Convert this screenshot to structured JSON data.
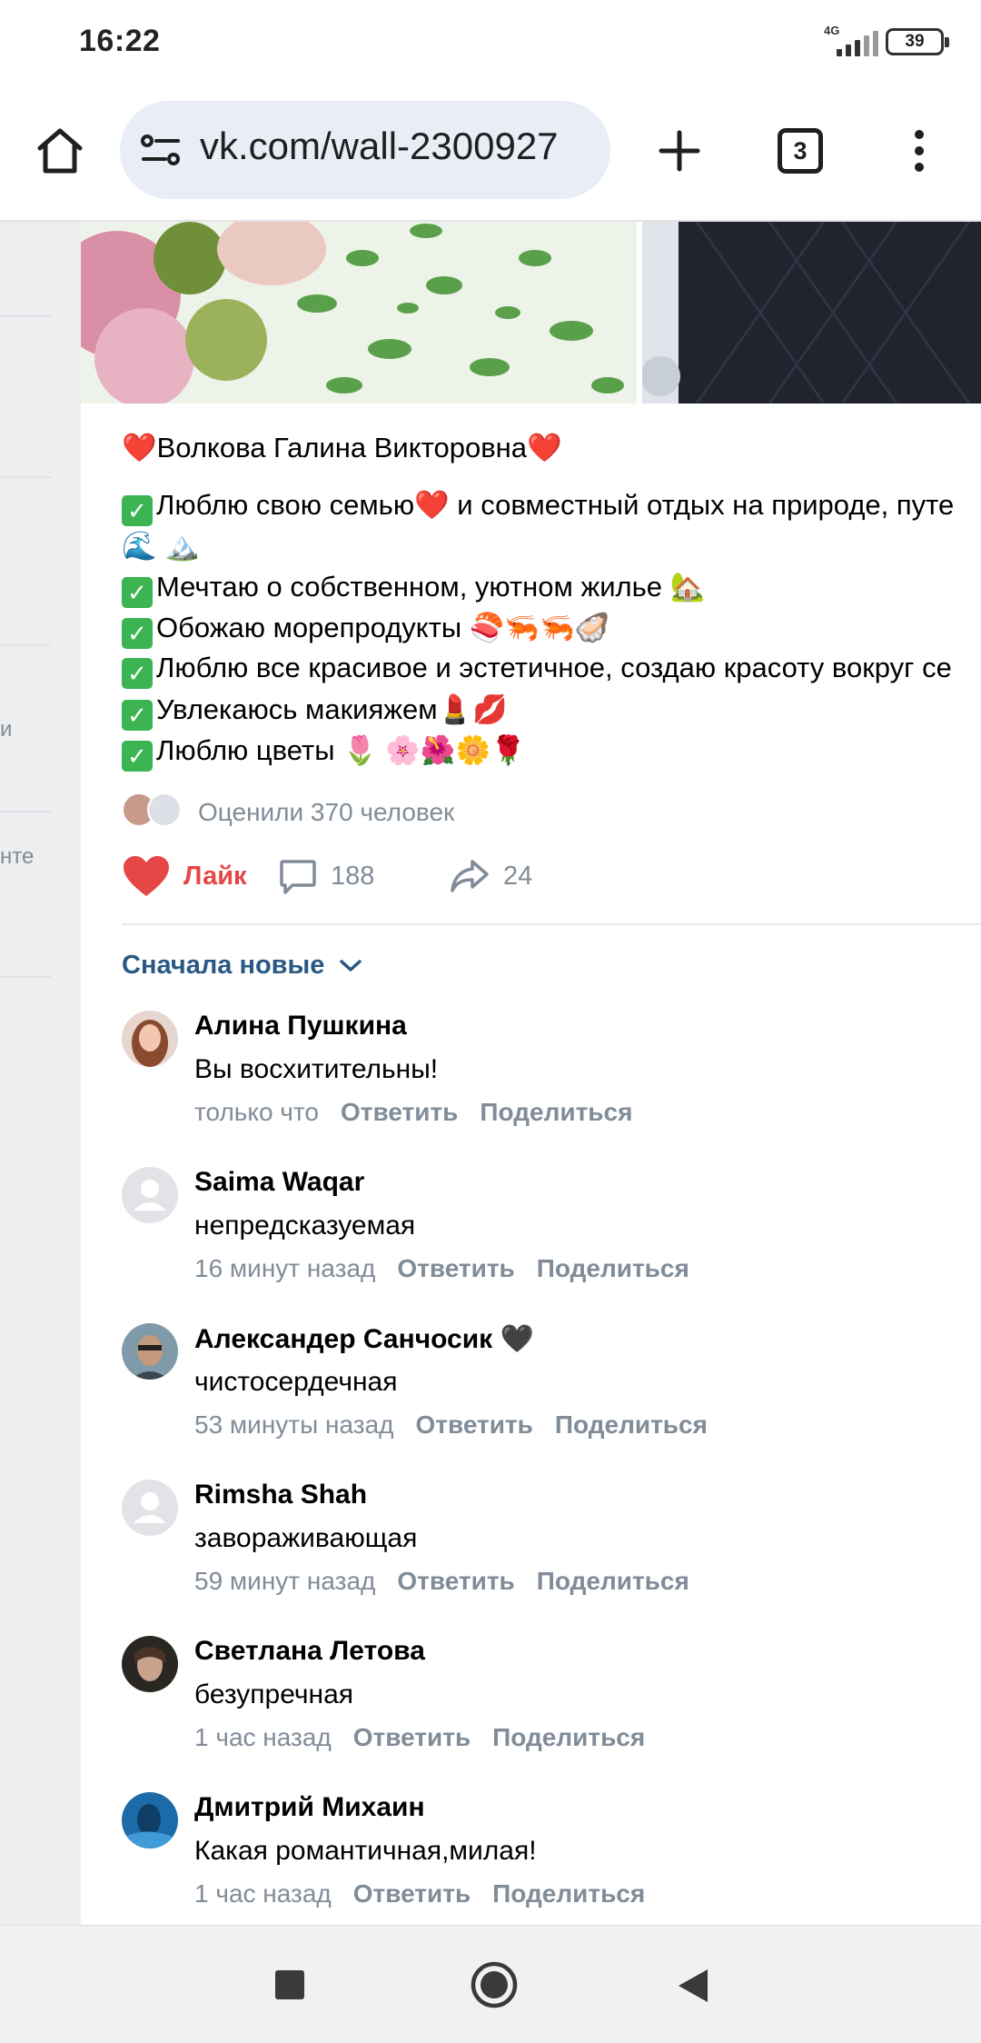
{
  "status_bar": {
    "time": "16:22",
    "network": "4G",
    "battery": "39"
  },
  "browser": {
    "url": "vk.com/wall-2300927",
    "tab_count": "3"
  },
  "sidebar_fragments": [
    "и",
    "нте"
  ],
  "post": {
    "title": "❤️Волкова Галина Викторовна❤️",
    "lines": [
      "Люблю свою семью❤️ и совместный отдых на природе, путе",
      "🌊 🏔️",
      "Мечтаю о собственном, уютном жилье 🏡",
      "Обожаю морепродукты 🍣🦐🦐🦪",
      "Люблю все красивое и эстетичное, создаю красоту вокруг се",
      "Увлекаюсь макияжем💄💋",
      "Люблю цветы 🌷 🌸🌺🌼🌹"
    ],
    "liked_by": "Оценили 370 человек",
    "like_label": "Лайк",
    "comments_count": "188",
    "shares_count": "24"
  },
  "comments_section": {
    "sort_label": "Сначала новые",
    "reply_label": "Ответить",
    "share_label": "Поделиться",
    "items": [
      {
        "name": "Алина Пушкина",
        "text": "Вы восхитительны!",
        "time": "только что",
        "avatar": "photo-woman-red"
      },
      {
        "name": "Saima Waqar",
        "text": "непредсказуемая",
        "time": "16 минут назад",
        "avatar": "default"
      },
      {
        "name": "Александер Санчосик",
        "text": "чистосердечная",
        "time": "53 минуты назад",
        "avatar": "photo-man",
        "badge": "🖤"
      },
      {
        "name": "Rimsha Shah",
        "text": "завораживающая",
        "time": "59 минут назад",
        "avatar": "default"
      },
      {
        "name": "Светлана Летова",
        "text": "безупречная",
        "time": "1 час назад",
        "avatar": "photo-woman-dark"
      },
      {
        "name": "Дмитрий Михаин",
        "text": "Какая романтичная,милая!",
        "time": "1 час назад",
        "avatar": "photo-blue"
      }
    ]
  },
  "colors": {
    "link": "#2a5885",
    "like": "#e64646",
    "muted": "#818c99",
    "check": "#3cb451"
  }
}
